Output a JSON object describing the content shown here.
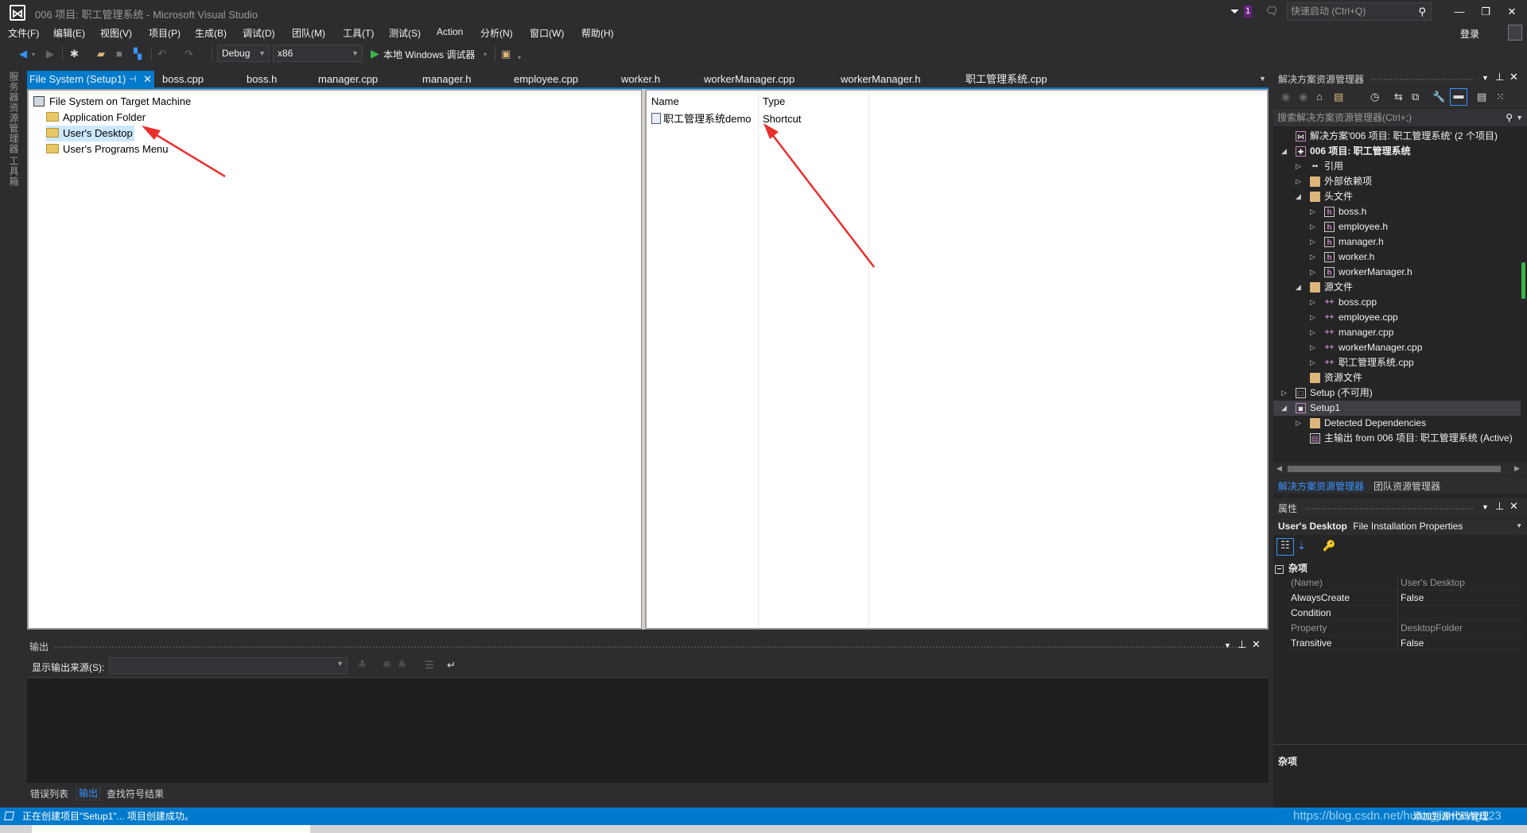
{
  "window": {
    "title": "006 项目: 职工管理系统 - Microsoft Visual Studio",
    "notification_count": "1",
    "quick_launch_placeholder": "快速启动 (Ctrl+Q)",
    "login": "登录",
    "controls": {
      "minimize": "—",
      "restore": "❐",
      "close": "✕"
    }
  },
  "menu": [
    "文件(F)",
    "编辑(E)",
    "视图(V)",
    "项目(P)",
    "生成(B)",
    "调试(D)",
    "团队(M)",
    "工具(T)",
    "测试(S)",
    "Action",
    "分析(N)",
    "窗口(W)",
    "帮助(H)"
  ],
  "toolbar": {
    "configuration": "Debug",
    "platform": "x86",
    "debugger": "本地 Windows 调试器"
  },
  "left_strip": {
    "items": [
      "服务器资源管理器",
      "工具箱"
    ]
  },
  "doc_tabs": [
    {
      "label": "File System (Setup1)",
      "active": true
    },
    {
      "label": "boss.cpp"
    },
    {
      "label": "boss.h"
    },
    {
      "label": "manager.cpp"
    },
    {
      "label": "manager.h"
    },
    {
      "label": "employee.cpp"
    },
    {
      "label": "worker.h"
    },
    {
      "label": "workerManager.cpp"
    },
    {
      "label": "workerManager.h"
    },
    {
      "label": "职工管理系统.cpp"
    }
  ],
  "file_system": {
    "root": "File System on Target Machine",
    "folders": [
      "Application Folder",
      "User's Desktop",
      "User's Programs Menu"
    ],
    "selected": "User's Desktop",
    "columns": [
      "Name",
      "Type"
    ],
    "items": [
      {
        "name": "职工管理系统demo",
        "type": "Shortcut"
      }
    ]
  },
  "annotations": {
    "arrow_color": "#e8302c"
  },
  "output": {
    "title": "输出",
    "source_label": "显示输出来源(S):",
    "source_value": ""
  },
  "bottom_tabs": [
    {
      "label": "错误列表"
    },
    {
      "label": "输出",
      "active": true
    },
    {
      "label": "查找符号结果"
    }
  ],
  "status": {
    "message": "正在创建项目\"Setup1\"... 项目创建成功。",
    "right": "添加到源代码管理",
    "watermark": "https://blog.csdn.net/huangjianhong123"
  },
  "solution_explorer": {
    "title": "解决方案资源管理器",
    "search_placeholder": "搜索解决方案资源管理器(Ctrl+;)",
    "tree": [
      {
        "label": "解决方案'006 项目: 职工管理系统' (2 个项目)",
        "depth": 0,
        "icon": "solution",
        "expander": ""
      },
      {
        "label": "006 项目: 职工管理系统",
        "depth": 0,
        "icon": "project",
        "expander": "expanded",
        "bold": true
      },
      {
        "label": "引用",
        "depth": 1,
        "icon": "references",
        "expander": "collapsed"
      },
      {
        "label": "外部依赖项",
        "depth": 1,
        "icon": "ext-deps",
        "expander": "collapsed"
      },
      {
        "label": "头文件",
        "depth": 1,
        "icon": "filter-folder",
        "expander": "expanded"
      },
      {
        "label": "boss.h",
        "depth": 2,
        "icon": "header",
        "expander": "collapsed"
      },
      {
        "label": "employee.h",
        "depth": 2,
        "icon": "header",
        "expander": "collapsed"
      },
      {
        "label": "manager.h",
        "depth": 2,
        "icon": "header",
        "expander": "collapsed"
      },
      {
        "label": "worker.h",
        "depth": 2,
        "icon": "header",
        "expander": "collapsed"
      },
      {
        "label": "workerManager.h",
        "depth": 2,
        "icon": "header",
        "expander": "collapsed"
      },
      {
        "label": "源文件",
        "depth": 1,
        "icon": "filter-folder",
        "expander": "expanded"
      },
      {
        "label": "boss.cpp",
        "depth": 2,
        "icon": "cpp",
        "expander": "collapsed"
      },
      {
        "label": "employee.cpp",
        "depth": 2,
        "icon": "cpp",
        "expander": "collapsed"
      },
      {
        "label": "manager.cpp",
        "depth": 2,
        "icon": "cpp",
        "expander": "collapsed"
      },
      {
        "label": "workerManager.cpp",
        "depth": 2,
        "icon": "cpp",
        "expander": "collapsed"
      },
      {
        "label": "职工管理系统.cpp",
        "depth": 2,
        "icon": "cpp",
        "expander": "collapsed"
      },
      {
        "label": "资源文件",
        "depth": 1,
        "icon": "filter-folder",
        "expander": ""
      },
      {
        "label": "Setup (不可用)",
        "depth": 0,
        "icon": "setup-unavailable",
        "expander": "collapsed"
      },
      {
        "label": "Setup1",
        "depth": 0,
        "icon": "setup",
        "expander": "expanded",
        "selected": true
      },
      {
        "label": "Detected Dependencies",
        "depth": 1,
        "icon": "folder",
        "expander": "collapsed"
      },
      {
        "label": "主输出 from 006 项目: 职工管理系统 (Active)",
        "depth": 1,
        "icon": "output",
        "expander": ""
      }
    ],
    "tabs": [
      {
        "label": "解决方案资源管理器",
        "active": true
      },
      {
        "label": "团队资源管理器"
      }
    ]
  },
  "properties": {
    "title": "属性",
    "object_name": "User's Desktop",
    "object_type": "File Installation Properties",
    "category": "杂项",
    "rows": [
      {
        "name": "(Name)",
        "value": "User's Desktop",
        "readonly": true
      },
      {
        "name": "AlwaysCreate",
        "value": "False"
      },
      {
        "name": "Condition",
        "value": ""
      },
      {
        "name": "Property",
        "value": "DesktopFolder",
        "readonly": true
      },
      {
        "name": "Transitive",
        "value": "False"
      }
    ],
    "description_title": "杂项"
  }
}
